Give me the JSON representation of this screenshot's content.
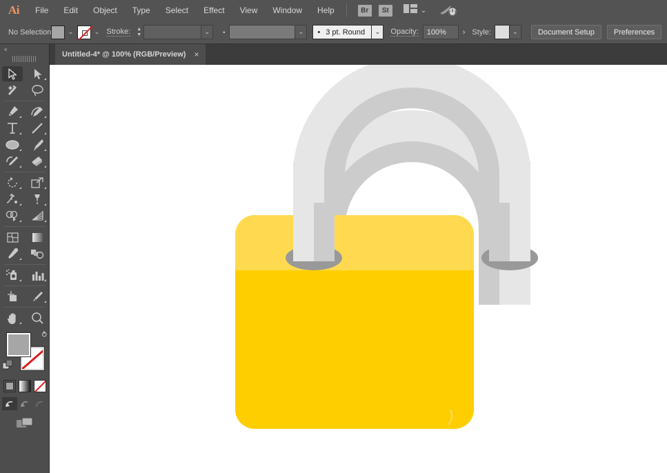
{
  "app": {
    "name": "Adobe Illustrator",
    "logo": "Ai"
  },
  "menubar": {
    "items": [
      {
        "label": "File"
      },
      {
        "label": "Edit"
      },
      {
        "label": "Object"
      },
      {
        "label": "Type"
      },
      {
        "label": "Select"
      },
      {
        "label": "Effect"
      },
      {
        "label": "View"
      },
      {
        "label": "Window"
      },
      {
        "label": "Help"
      }
    ],
    "bridge_label": "Br",
    "stock_label": "St",
    "workspace_icon": "workspace-layout-icon",
    "workspace_chevron": "⌄",
    "rocket_icon": "rocket-power-icon"
  },
  "controlbar": {
    "selection_status": "No Selection",
    "fill_swatch_color": "#a6a6a6",
    "fill_chevron": "⌄",
    "stroke_swatch_state": "none",
    "stroke_chevron": "⌄",
    "stroke_label": "Stroke:",
    "stroke_weight_value": "",
    "stroke_weight_chevron": "⌄",
    "variable_width_value": "",
    "variable_width_chevron": "⌄",
    "brush_bullet": "•",
    "brush_definition": "3 pt. Round",
    "brush_chevron": "⌄",
    "opacity_label": "Opacity:",
    "opacity_value": "100%",
    "opacity_more": "›",
    "style_label": "Style:",
    "style_chevron": "⌄",
    "document_setup_label": "Document Setup",
    "preferences_label": "Preferences",
    "align_chevron": "⌄"
  },
  "tabbar": {
    "document_title": "Untitled-4* @ 100% (RGB/Preview)",
    "close_glyph": "×"
  },
  "toolbar": {
    "collapse_glyph": "«",
    "tools": [
      {
        "name": "selection-tool",
        "active": true,
        "corner": false
      },
      {
        "name": "direct-selection-tool",
        "active": false,
        "corner": true
      },
      {
        "name": "magic-wand-tool",
        "active": false,
        "corner": false
      },
      {
        "name": "lasso-tool",
        "active": false,
        "corner": false
      },
      {
        "name": "pen-tool",
        "active": false,
        "corner": true
      },
      {
        "name": "curvature-tool",
        "active": false,
        "corner": true
      },
      {
        "name": "type-tool",
        "active": false,
        "corner": true
      },
      {
        "name": "line-segment-tool",
        "active": false,
        "corner": true
      },
      {
        "name": "ellipse-tool",
        "active": false,
        "corner": true
      },
      {
        "name": "paintbrush-tool",
        "active": false,
        "corner": true
      },
      {
        "name": "shaper-tool",
        "active": false,
        "corner": true
      },
      {
        "name": "eraser-tool",
        "active": false,
        "corner": true
      },
      {
        "name": "rotate-tool",
        "active": false,
        "corner": true
      },
      {
        "name": "scale-tool",
        "active": false,
        "corner": true
      },
      {
        "name": "width-tool",
        "active": false,
        "corner": true
      },
      {
        "name": "free-transform-tool",
        "active": false,
        "corner": true
      },
      {
        "name": "shape-builder-tool",
        "active": false,
        "corner": true
      },
      {
        "name": "perspective-grid-tool",
        "active": false,
        "corner": true
      },
      {
        "name": "mesh-tool",
        "active": false,
        "corner": false
      },
      {
        "name": "gradient-tool",
        "active": false,
        "corner": false
      },
      {
        "name": "eyedropper-tool",
        "active": false,
        "corner": true
      },
      {
        "name": "blend-tool",
        "active": false,
        "corner": false
      },
      {
        "name": "symbol-sprayer-tool",
        "active": false,
        "corner": true
      },
      {
        "name": "column-graph-tool",
        "active": false,
        "corner": true
      },
      {
        "name": "artboard-tool",
        "active": false,
        "corner": false
      },
      {
        "name": "slice-tool",
        "active": false,
        "corner": true
      },
      {
        "name": "hand-tool",
        "active": false,
        "corner": true
      },
      {
        "name": "zoom-tool",
        "active": false,
        "corner": false
      }
    ],
    "fill_color": "#a6a6a6",
    "stroke_color": "none",
    "swap_glyph": "⥁",
    "mini_buttons": [
      "color-button",
      "gradient-button",
      "none-button"
    ],
    "draw_modes": [
      "draw-normal",
      "draw-behind",
      "draw-inside"
    ],
    "screen_mode": "screen-mode-button"
  },
  "artwork": {
    "name": "padlock-illustration",
    "body_color": "#ffce00",
    "body_top_band_color": "#ffda51",
    "shackle_outer_color": "#e6e6e6",
    "shackle_inner_color": "#cccccc",
    "shackle_base_shadow_color": "#999999",
    "zoom_level": "100%"
  },
  "colors": {
    "chrome_bg": "#535353",
    "panel_bg": "#4d4d4d",
    "tabbar_bg": "#3c3c3c",
    "canvas_bg": "#ffffff",
    "accent_logo": "#f0955f"
  }
}
